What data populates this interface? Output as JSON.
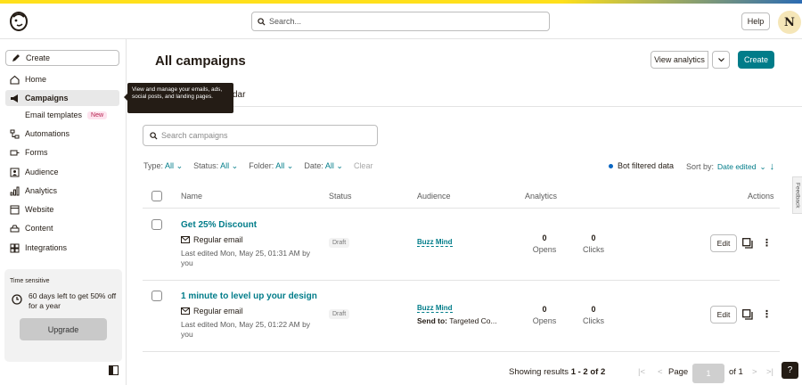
{
  "topbar": {
    "search_placeholder": "Search...",
    "help_label": "Help",
    "avatar_initial": "N"
  },
  "sidebar": {
    "create_label": "Create",
    "items": [
      {
        "label": "Home",
        "icon": "home-icon"
      },
      {
        "label": "Campaigns",
        "icon": "megaphone-icon",
        "active": true
      },
      {
        "label": "Automations",
        "icon": "automation-icon"
      },
      {
        "label": "Forms",
        "icon": "forms-icon"
      },
      {
        "label": "Audience",
        "icon": "audience-icon"
      },
      {
        "label": "Analytics",
        "icon": "analytics-icon"
      },
      {
        "label": "Website",
        "icon": "website-icon"
      },
      {
        "label": "Content",
        "icon": "content-icon"
      },
      {
        "label": "Integrations",
        "icon": "integrations-icon"
      }
    ],
    "subitem_label": "Email templates",
    "subitem_badge": "New",
    "promo": {
      "tag": "Time sensitive",
      "message": "60 days left to get 50% off for a year",
      "button": "Upgrade"
    }
  },
  "tooltip": {
    "text": "View and manage your emails, ads, social posts, and landing pages."
  },
  "main": {
    "title": "All campaigns",
    "view_analytics_label": "View analytics",
    "create_label": "Create",
    "tab_partial": "dar",
    "search_placeholder": "Search campaigns",
    "filters": [
      {
        "label": "Type:",
        "value": "All"
      },
      {
        "label": "Status:",
        "value": "All"
      },
      {
        "label": "Folder:",
        "value": "All"
      },
      {
        "label": "Date:",
        "value": "All"
      }
    ],
    "clear_label": "Clear",
    "bot_label": "Bot filtered data",
    "sort_label": "Sort by:",
    "sort_value": "Date edited",
    "headers": {
      "name": "Name",
      "status": "Status",
      "audience": "Audience",
      "analytics": "Analytics",
      "actions": "Actions"
    },
    "campaigns": [
      {
        "name": "Get 25% Discount",
        "type": "Regular email",
        "edited": "Last edited Mon, May 25, 01:31 AM by you",
        "status": "Draft",
        "audience": "Buzz Mind",
        "send_to": "",
        "opens": "0",
        "opens_label": "Opens",
        "clicks": "0",
        "clicks_label": "Clicks",
        "edit_label": "Edit"
      },
      {
        "name": "1 minute to level up your design",
        "type": "Regular email",
        "edited": "Last edited Mon, May 25, 01:22 AM by you",
        "status": "Draft",
        "audience": "Buzz Mind",
        "send_to": "Targeted Co...",
        "send_to_label": "Send to:",
        "opens": "0",
        "opens_label": "Opens",
        "clicks": "0",
        "clicks_label": "Clicks",
        "edit_label": "Edit"
      }
    ],
    "pagination": {
      "showing_prefix": "Showing results ",
      "showing_range": "1 - 2 of 2",
      "page_label": "Page",
      "page_value": "1",
      "of_label": "of 1"
    },
    "feedback_label": "Feedback",
    "help_q": "?"
  },
  "colors": {
    "accent": "#007c89",
    "brand_yellow": "#ffe01b",
    "dark": "#241c15"
  }
}
